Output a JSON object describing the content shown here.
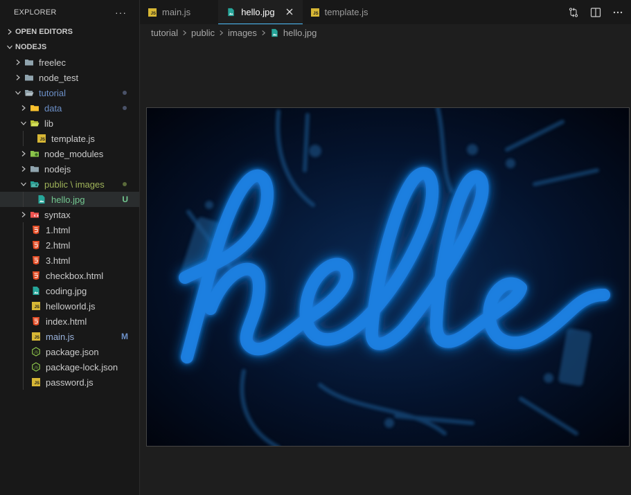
{
  "explorer": {
    "title": "EXPLORER",
    "more": "···",
    "open_editors": "OPEN EDITORS",
    "workspace": "NODEJS"
  },
  "tree": [
    {
      "label": "freelec",
      "kind": "folder",
      "icon": "folder-icon"
    },
    {
      "label": "node_test",
      "kind": "folder",
      "icon": "folder-icon"
    },
    {
      "label": "tutorial",
      "kind": "folder-open",
      "icon": "folder-open-icon"
    },
    {
      "label": "data",
      "kind": "folder",
      "icon": "folder-icon"
    },
    {
      "label": "lib",
      "kind": "folder-open",
      "icon": "folder-lib-icon"
    },
    {
      "label": "template.js",
      "kind": "file",
      "icon": "js-file-icon"
    },
    {
      "label": "node_modules",
      "kind": "folder",
      "icon": "node-modules-folder-icon"
    },
    {
      "label": "nodejs",
      "kind": "folder",
      "icon": "folder-icon"
    },
    {
      "label": "public \\ images",
      "kind": "folder-open",
      "icon": "images-folder-icon"
    },
    {
      "label": "hello.jpg",
      "kind": "file",
      "icon": "image-file-icon",
      "badge": "U"
    },
    {
      "label": "syntax",
      "kind": "folder",
      "icon": "syntax-folder-icon"
    },
    {
      "label": "1.html",
      "kind": "file",
      "icon": "html-file-icon"
    },
    {
      "label": "2.html",
      "kind": "file",
      "icon": "html-file-icon"
    },
    {
      "label": "3.html",
      "kind": "file",
      "icon": "html-file-icon"
    },
    {
      "label": "checkbox.html",
      "kind": "file",
      "icon": "html-file-icon"
    },
    {
      "label": "coding.jpg",
      "kind": "file",
      "icon": "image-file-icon"
    },
    {
      "label": "helloworld.js",
      "kind": "file",
      "icon": "js-file-icon"
    },
    {
      "label": "index.html",
      "kind": "file",
      "icon": "html-file-icon"
    },
    {
      "label": "main.js",
      "kind": "file",
      "icon": "js-file-icon",
      "badge": "M"
    },
    {
      "label": "package.json",
      "kind": "file",
      "icon": "nodejs-file-icon"
    },
    {
      "label": "package-lock.json",
      "kind": "file",
      "icon": "nodejs-file-icon"
    },
    {
      "label": "password.js",
      "kind": "file",
      "icon": "js-file-icon"
    }
  ],
  "tabs": [
    {
      "label": "main.js",
      "icon": "js-file-icon"
    },
    {
      "label": "hello.jpg",
      "icon": "image-file-icon",
      "active": true
    },
    {
      "label": "template.js",
      "icon": "js-file-icon"
    }
  ],
  "breadcrumb": [
    "tutorial",
    "public",
    "images",
    "hello.jpg"
  ],
  "image": {
    "neon_text": "hello"
  },
  "js_icon_text": "JS",
  "colors": {
    "accent": "#4fc1ff",
    "untracked": "#73c991",
    "modified": "#d7ba7d",
    "js": "#d7b735",
    "html": "#e44d26",
    "neon": "#2fb6ff"
  }
}
